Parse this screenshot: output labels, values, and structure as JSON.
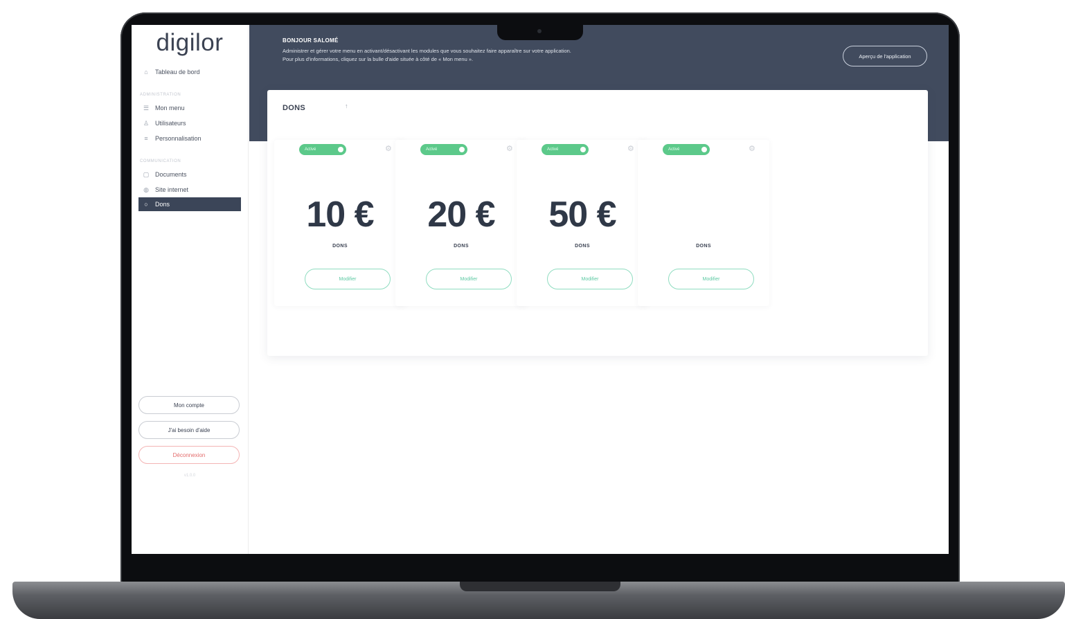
{
  "app": {
    "logo": "digilor"
  },
  "sidebar": {
    "dashboard": {
      "label": "Tableau de bord",
      "icon": "home-icon"
    },
    "section1": "ADMINISTRATION",
    "items1": [
      {
        "label": "Mon menu",
        "icon": "menu-icon"
      },
      {
        "label": "Utilisateurs",
        "icon": "users-icon"
      },
      {
        "label": "Personnalisation",
        "icon": "customize-icon"
      }
    ],
    "section2": "COMMUNICATION",
    "items2": [
      {
        "label": "Documents",
        "icon": "document-icon"
      },
      {
        "label": "Site internet",
        "icon": "globe-icon"
      },
      {
        "label": "Dons",
        "icon": "donation-icon",
        "active": true
      }
    ],
    "account_button": "Mon compte",
    "help_button": "J'ai besoin d'aide",
    "logout_button": "Déconnexion",
    "version": "v1.0.0"
  },
  "header": {
    "greeting": "BONJOUR SALOMÉ",
    "intro_line1": "Administrer et gérer votre menu en activant/désactivant les modules que vous souhaitez faire apparaître sur votre application.",
    "intro_line2": "Pour plus d'informations, cliquez sur la bulle d'aide située à côté de « Mon menu ».",
    "preview_button": "Aperçu de l'application"
  },
  "panel": {
    "title": "DONS",
    "sort_icon": "↑"
  },
  "cards": [
    {
      "toggle_label": "Activé",
      "amount": "10 €",
      "label": "DONS",
      "button": "Modifier"
    },
    {
      "toggle_label": "Activé",
      "amount": "20 €",
      "label": "DONS",
      "button": "Modifier"
    },
    {
      "toggle_label": "Activé",
      "amount": "50 €",
      "label": "DONS",
      "button": "Modifier"
    },
    {
      "toggle_label": "Activé",
      "amount": "",
      "label": "DONS",
      "button": "Modifier"
    }
  ],
  "colors": {
    "header_bg": "#414b5e",
    "active_nav": "#3b4558",
    "toggle_on": "#5cc98a",
    "edit_accent": "#5cc9a3",
    "danger": "#e36b6b"
  }
}
